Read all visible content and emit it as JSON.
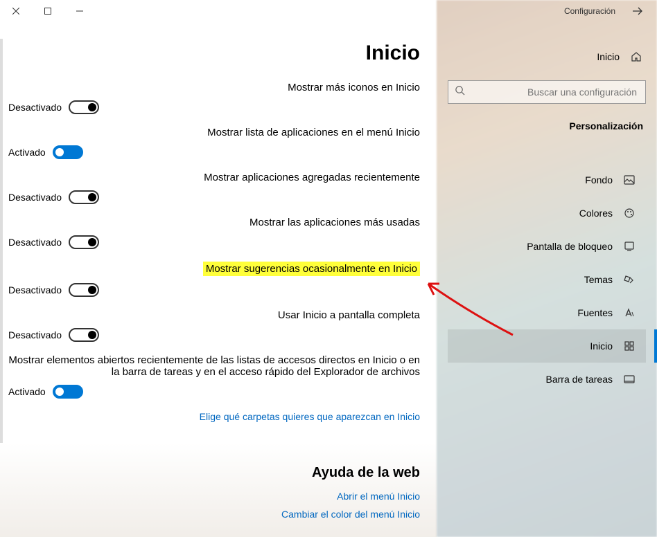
{
  "titlebar": {
    "title": "Configuración"
  },
  "home": {
    "label": "Inicio"
  },
  "search": {
    "placeholder": "Buscar una configuración"
  },
  "category_header": "Personalización",
  "nav": [
    {
      "key": "fondo",
      "label": "Fondo"
    },
    {
      "key": "colores",
      "label": "Colores"
    },
    {
      "key": "bloqueo",
      "label": "Pantalla de bloqueo"
    },
    {
      "key": "temas",
      "label": "Temas"
    },
    {
      "key": "fuentes",
      "label": "Fuentes"
    },
    {
      "key": "inicio",
      "label": "Inicio",
      "selected": true
    },
    {
      "key": "barra",
      "label": "Barra de tareas"
    }
  ],
  "page": {
    "title": "Inicio"
  },
  "states": {
    "on": "Activado",
    "off": "Desactivado"
  },
  "settings": [
    {
      "label": "Mostrar más iconos en Inicio",
      "on": false
    },
    {
      "label": "Mostrar lista de aplicaciones en el menú Inicio",
      "on": true
    },
    {
      "label": "Mostrar aplicaciones agregadas recientemente",
      "on": false
    },
    {
      "label": "Mostrar las aplicaciones más usadas",
      "on": false
    },
    {
      "label": "Mostrar sugerencias ocasionalmente en Inicio",
      "on": false,
      "highlight": true
    },
    {
      "label": "Usar Inicio a pantalla completa",
      "on": false
    },
    {
      "label": "Mostrar elementos abiertos recientemente de las listas de accesos directos en Inicio o en la barra de tareas y en el acceso rápido del Explorador de archivos",
      "on": true
    }
  ],
  "choose_link": "Elige qué carpetas quieres que aparezcan en Inicio",
  "help": {
    "header": "Ayuda de la web",
    "links": [
      "Abrir el menú Inicio",
      "Cambiar el color del menú Inicio"
    ]
  }
}
